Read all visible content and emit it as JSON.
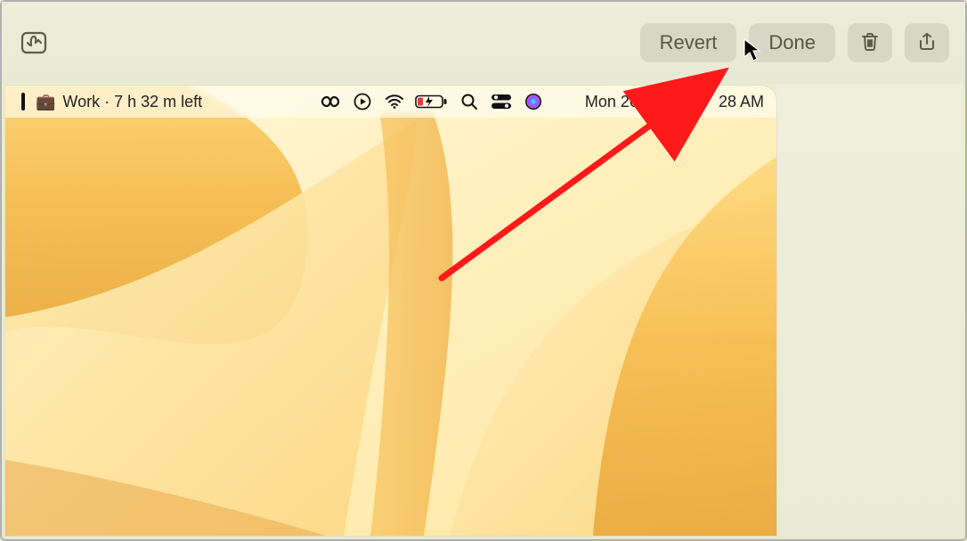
{
  "toolbar": {
    "revert_label": "Revert",
    "done_label": "Done"
  },
  "menubar": {
    "focus_name": "Work",
    "time_remaining": "7 h 32 m left",
    "date": "Mon 26 Sept",
    "time": "28 AM"
  },
  "icons": {
    "markup": "markup-icon",
    "trash": "trash-icon",
    "share": "share-icon",
    "briefcase": "briefcase-icon",
    "infinity": "infinity-icon",
    "play": "play-icon",
    "wifi": "wifi-icon",
    "battery": "battery-low-charging-icon",
    "search": "search-icon",
    "control_center": "control-center-icon",
    "siri": "siri-icon"
  }
}
